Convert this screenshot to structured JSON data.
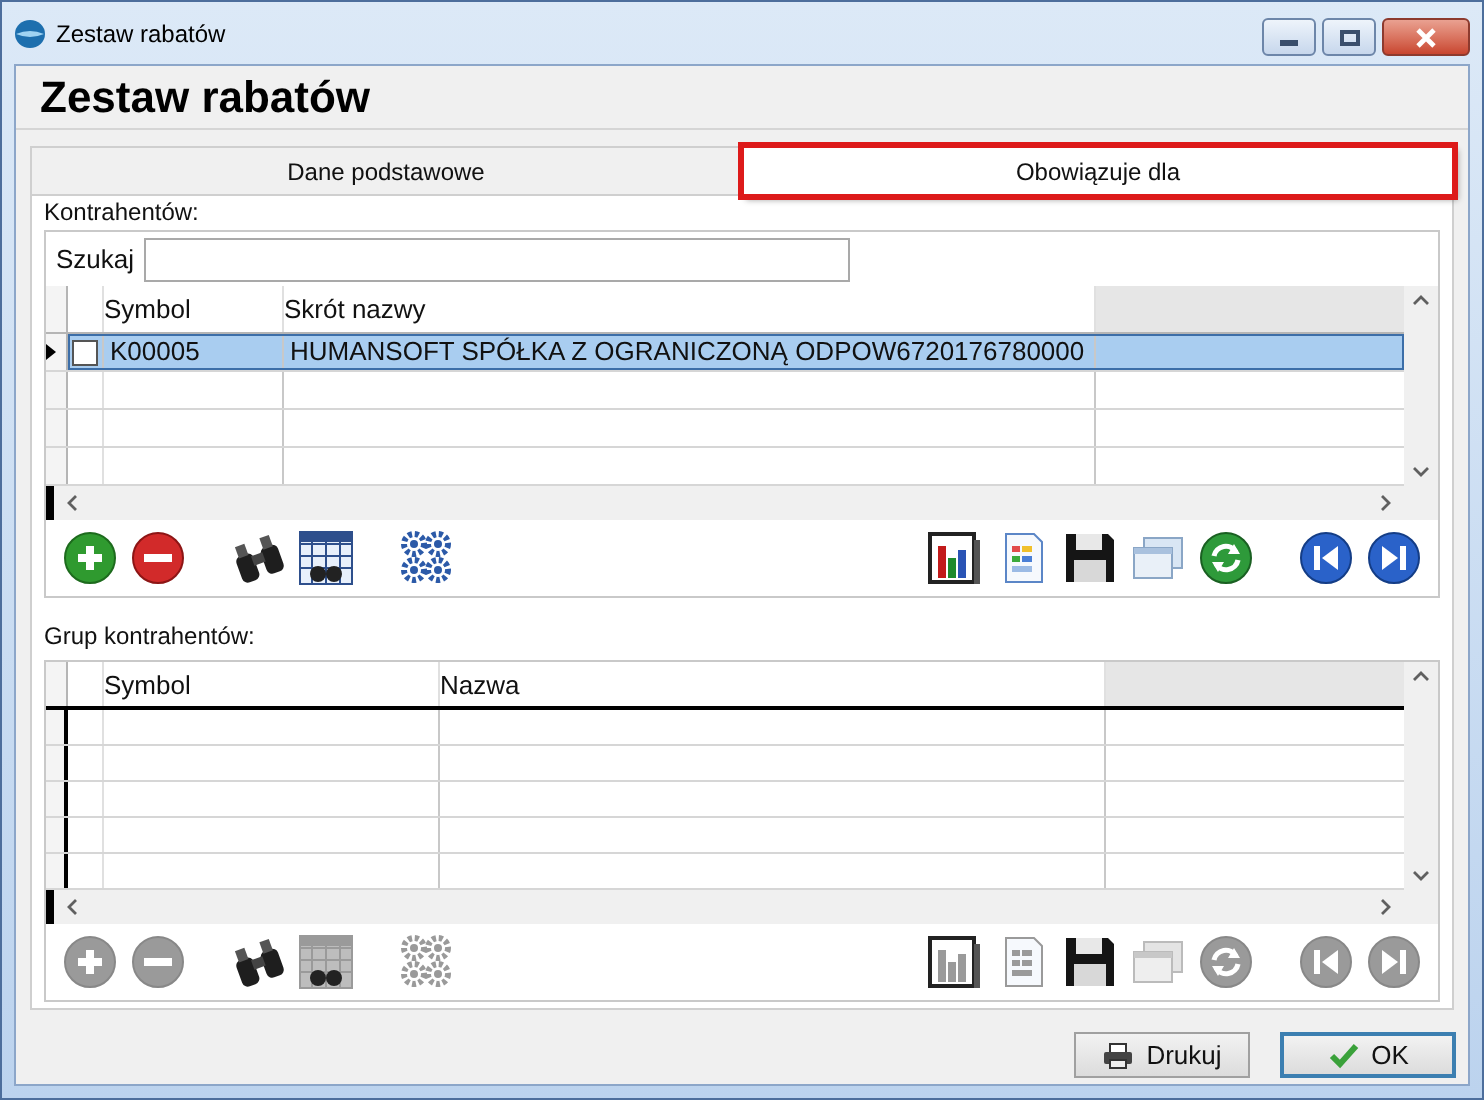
{
  "window": {
    "title": "Zestaw rabatów"
  },
  "heading": "Zestaw rabatów",
  "tabs": [
    {
      "label": "Dane podstawowe",
      "selected": false,
      "highlighted": false
    },
    {
      "label": "Obowiązuje dla",
      "selected": true,
      "highlighted": true
    }
  ],
  "contractors": {
    "label": "Kontrahentów:",
    "search": {
      "label": "Szukaj"
    },
    "columns": [
      "Symbol",
      "Skrót nazwy"
    ],
    "rows": [
      {
        "selected": true,
        "current": true,
        "checked": false,
        "cells": [
          "K00005",
          "HUMANSOFT SPÓŁKA Z OGRANICZONĄ ODPOW6720176780000"
        ]
      }
    ],
    "toolbar": {
      "disabled": false
    }
  },
  "groups": {
    "label": "Grup kontrahentów:",
    "columns": [
      "Symbol",
      "Nazwa"
    ],
    "toolbar": {
      "disabled": true
    }
  },
  "buttons": [
    {
      "label": "Drukuj",
      "kind": "print",
      "default": false
    },
    {
      "label": "OK",
      "kind": "ok",
      "default": true
    }
  ]
}
